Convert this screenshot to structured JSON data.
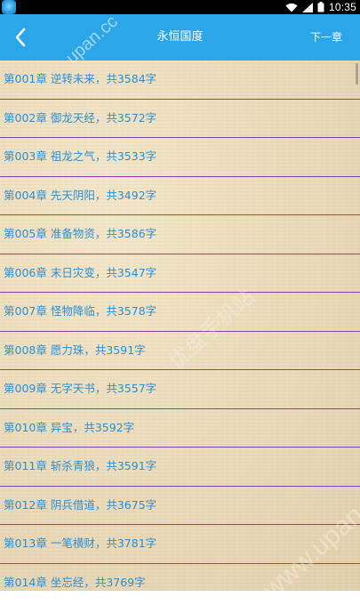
{
  "status_bar": {
    "time": "10:35",
    "icons": [
      "wifi-icon",
      "signal-icon",
      "battery-icon"
    ]
  },
  "app_bar": {
    "title": "永恒国度",
    "next_label": "下一章",
    "back_icon": "chevron-left-icon",
    "color": "#2ba6e8"
  },
  "chapters": [
    {
      "text": "第001章 逆转未来，共3584字"
    },
    {
      "text": "第002章 御龙天经，共3572字"
    },
    {
      "text": "第003章 祖龙之气，共3533字"
    },
    {
      "text": "第004章 先天阴阳，共3492字"
    },
    {
      "text": "第005章 准备物资，共3586字"
    },
    {
      "text": "第006章 末日灾变，共3547字"
    },
    {
      "text": "第007章 怪物降临，共3578字"
    },
    {
      "text": "第008章 愿力珠，共3591字"
    },
    {
      "text": "第009章 无字天书，共3557字"
    },
    {
      "text": "第010章 异宝，共3592字"
    },
    {
      "text": "第011章 斩杀青狼，共3591字"
    },
    {
      "text": "第012章 阴兵借道，共3675字"
    },
    {
      "text": "第013章 一笔横财，共3781字"
    },
    {
      "text": "第014章 坐忘经，共3769字"
    }
  ],
  "watermarks": {
    "top": "upan.cc",
    "middle": "优盘手机站",
    "bottom": "www.upan.cc"
  },
  "colors": {
    "chapter_text": "#2b8fd8",
    "divider": "#8a3fb3",
    "background": "#e8d8b6"
  }
}
